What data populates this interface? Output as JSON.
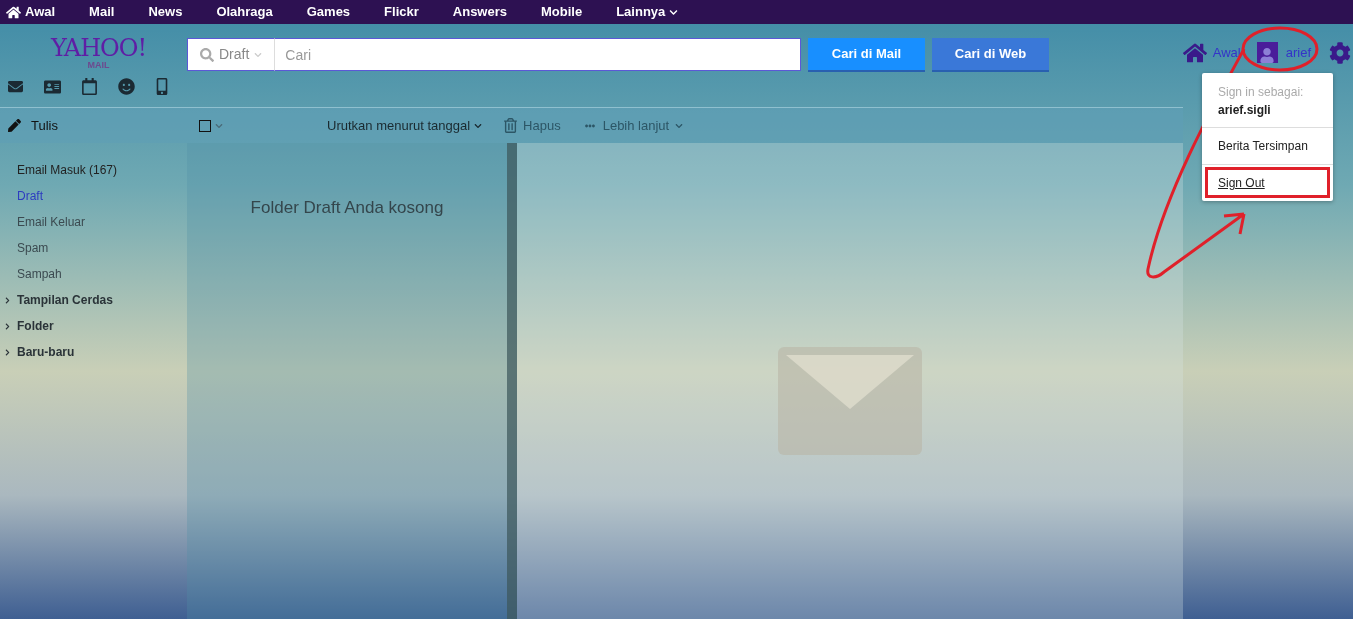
{
  "top_nav": [
    {
      "label": "Awal",
      "kind": "home"
    },
    {
      "label": "Mail",
      "kind": "link"
    },
    {
      "label": "News",
      "kind": "link"
    },
    {
      "label": "Olahraga",
      "kind": "link"
    },
    {
      "label": "Games",
      "kind": "link"
    },
    {
      "label": "Flickr",
      "kind": "link"
    },
    {
      "label": "Answers",
      "kind": "link"
    },
    {
      "label": "Mobile",
      "kind": "link"
    },
    {
      "label": "Lainnya",
      "kind": "menu"
    }
  ],
  "logo": {
    "brand": "YAHOO!",
    "product": "MAIL"
  },
  "search": {
    "scope": "Draft",
    "placeholder": "Cari",
    "buttons": [
      "Cari di Mail",
      "Cari di Web"
    ]
  },
  "header_links": {
    "home": "Awal",
    "user": "arief"
  },
  "compose": "Tulis",
  "folders": [
    {
      "label": "Email Masuk (167)",
      "kind": "folder",
      "selected": false
    },
    {
      "label": "Draft",
      "kind": "folder",
      "selected": true
    },
    {
      "label": "Email Keluar",
      "kind": "folder",
      "selected": false
    },
    {
      "label": "Spam",
      "kind": "folder",
      "selected": false
    },
    {
      "label": "Sampah",
      "kind": "folder",
      "selected": false
    },
    {
      "label": "Tampilan Cerdas",
      "kind": "group",
      "selected": false
    },
    {
      "label": "Folder",
      "kind": "group",
      "selected": false
    },
    {
      "label": "Baru-baru",
      "kind": "group",
      "selected": false
    }
  ],
  "toolbar": {
    "select_all": {
      "checked": false
    },
    "sort": "Urutkan menurut tanggal",
    "actions": [
      {
        "label": "Hapus",
        "kind": "delete",
        "disabled": true
      },
      {
        "label": "Lebih lanjut",
        "kind": "more",
        "disabled": true
      }
    ]
  },
  "message_list": {
    "empty_text": "Folder Draft Anda kosong"
  },
  "account_menu": {
    "caption": "Sign in sebagai:",
    "username": "arief.sigli",
    "items": [
      {
        "label": "Berita Tersimpan",
        "highlighted": false
      },
      {
        "label": "Sign Out",
        "highlighted": true
      }
    ]
  }
}
